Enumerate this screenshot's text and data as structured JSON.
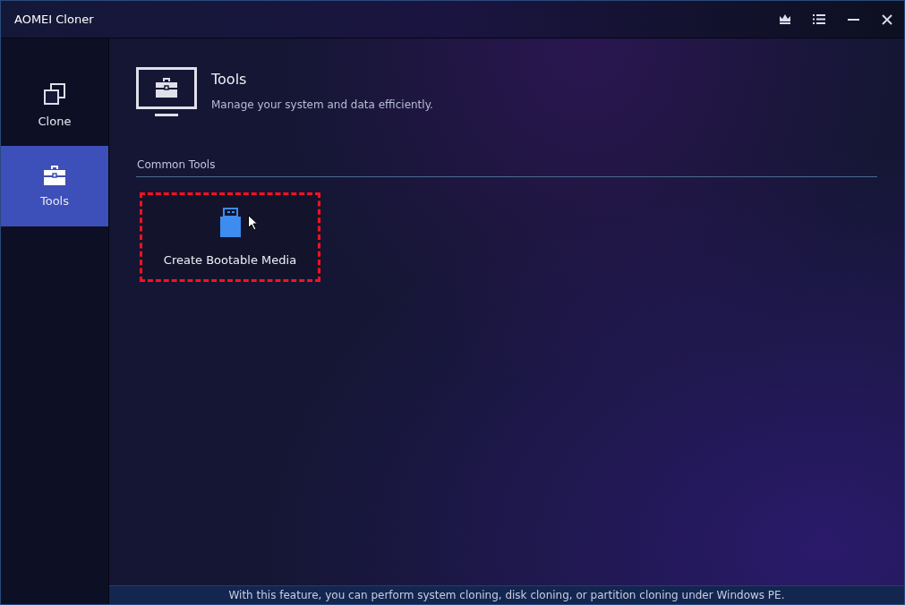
{
  "window": {
    "title": "AOMEI Cloner"
  },
  "title_bar_buttons": [
    {
      "kind": "upgrade"
    },
    {
      "kind": "menu"
    },
    {
      "kind": "minimize"
    },
    {
      "kind": "close"
    }
  ],
  "sidebar": {
    "items": [
      {
        "label": "Clone",
        "kind": "clone",
        "selected": false
      },
      {
        "label": "Tools",
        "kind": "tools",
        "selected": true
      }
    ]
  },
  "header": {
    "title": "Tools",
    "subtitle": "Manage your system and data efficiently."
  },
  "section": {
    "title": "Common Tools",
    "tools": [
      {
        "label": "Create Bootable Media",
        "kind": "usb",
        "highlighted": true
      }
    ]
  },
  "status_bar": "With this feature, you can perform system cloning, disk cloning, or partition cloning under Windows PE."
}
